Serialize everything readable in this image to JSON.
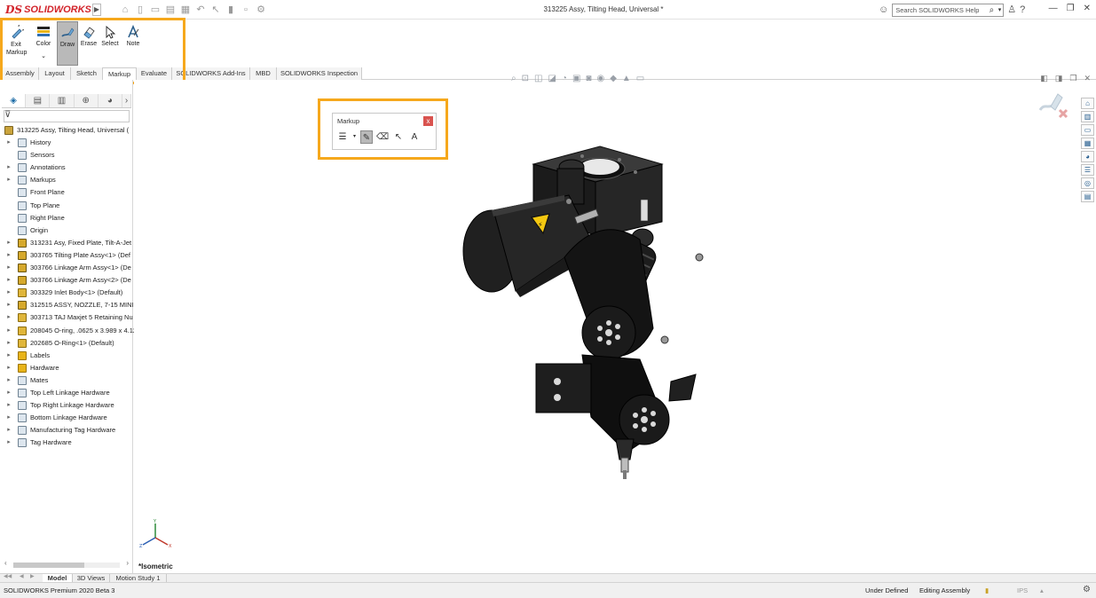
{
  "app": {
    "logo_ds": "DS",
    "logo_text": "SOLIDWORKS",
    "document_title": "313225 Assy, Tilting Head, Universal *",
    "help_search_placeholder": "Search SOLIDWORKS Help"
  },
  "ribbon": {
    "buttons": {
      "exit_markup": "Exit Markup",
      "color": "Color",
      "draw": "Draw",
      "erase": "Erase",
      "select": "Select",
      "note": "Note"
    },
    "tabs": [
      "Assembly",
      "Layout",
      "Sketch",
      "Markup",
      "Evaluate",
      "SOLIDWORKS Add-Ins",
      "MBD",
      "SOLIDWORKS Inspection"
    ],
    "active_tab": "Markup"
  },
  "markup_flyout": {
    "title": "Markup"
  },
  "feature_tree": {
    "root": "313225 Assy, Tilting Head, Universal  (",
    "items": [
      {
        "label": "History",
        "expandable": true
      },
      {
        "label": "Sensors",
        "expandable": false
      },
      {
        "label": "Annotations",
        "expandable": true
      },
      {
        "label": "Markups",
        "expandable": true
      },
      {
        "label": "Front Plane",
        "expandable": false
      },
      {
        "label": "Top Plane",
        "expandable": false
      },
      {
        "label": "Right Plane",
        "expandable": false
      },
      {
        "label": "Origin",
        "expandable": false
      },
      {
        "label": "313231 Asy, Fixed Plate, Tilt-A-Jet",
        "expandable": true
      },
      {
        "label": "303765 Tilting Plate Assy<1> (Def",
        "expandable": true
      },
      {
        "label": "303766 Linkage Arm Assy<1> (De",
        "expandable": true
      },
      {
        "label": "303766 Linkage Arm Assy<2> (De",
        "expandable": true
      },
      {
        "label": "303329 Inlet Body<1> (Default)",
        "expandable": true
      },
      {
        "label": "312515 ASSY, NOZZLE, 7-15 MINI",
        "expandable": true
      },
      {
        "label": "303713 TAJ Maxjet 5 Retaining Nu",
        "expandable": true
      },
      {
        "label": "208045 O-ring, .0625 x 3.989 x 4.12",
        "expandable": true
      },
      {
        "label": "202685 O-Ring<1> (Default)",
        "expandable": true
      },
      {
        "label": "Labels",
        "expandable": true
      },
      {
        "label": "Hardware",
        "expandable": true
      },
      {
        "label": "Mates",
        "expandable": true
      },
      {
        "label": "Top Left Linkage Hardware",
        "expandable": true
      },
      {
        "label": "Top Right Linkage Hardware",
        "expandable": true
      },
      {
        "label": "Bottom Linkage Hardware",
        "expandable": true
      },
      {
        "label": "Manufacturing Tag Hardware",
        "expandable": true
      },
      {
        "label": "Tag Hardware",
        "expandable": true
      }
    ]
  },
  "viewport": {
    "orientation": "*Isometric"
  },
  "bottom_tabs": [
    "Model",
    "3D Views",
    "Motion Study 1"
  ],
  "active_bottom_tab": "Model",
  "status": {
    "product": "SOLIDWORKS Premium 2020 Beta 3",
    "state": "Under Defined",
    "mode": "Editing Assembly",
    "units": "IPS"
  },
  "colors": {
    "highlight": "#f6a81c",
    "brand": "#d2232a"
  }
}
